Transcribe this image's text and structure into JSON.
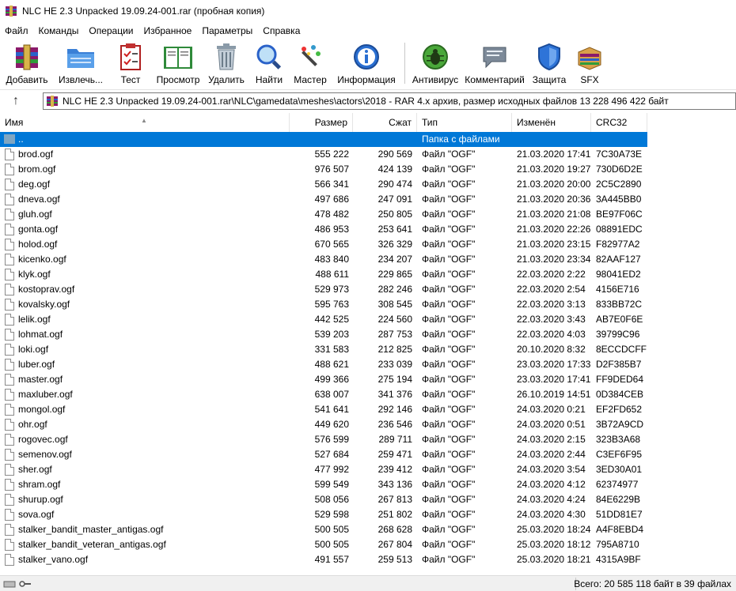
{
  "window": {
    "title": "NLC HE 2.3 Unpacked 19.09.24-001.rar (пробная копия)"
  },
  "menu": [
    "Файл",
    "Команды",
    "Операции",
    "Избранное",
    "Параметры",
    "Справка"
  ],
  "toolbar": [
    {
      "label": "Добавить",
      "icon": "archive-add-icon"
    },
    {
      "label": "Извлечь...",
      "icon": "folder-extract-icon"
    },
    {
      "label": "Тест",
      "icon": "test-checklist-icon"
    },
    {
      "label": "Просмотр",
      "icon": "book-view-icon"
    },
    {
      "label": "Удалить",
      "icon": "trash-icon"
    },
    {
      "label": "Найти",
      "icon": "magnifier-icon"
    },
    {
      "label": "Мастер",
      "icon": "wizard-wand-icon"
    },
    {
      "label": "Информация",
      "icon": "info-icon"
    },
    {
      "label": "Антивирус",
      "icon": "bug-antivirus-icon"
    },
    {
      "label": "Комментарий",
      "icon": "comment-icon"
    },
    {
      "label": "Защита",
      "icon": "shield-icon"
    },
    {
      "label": "SFX",
      "icon": "sfx-box-icon"
    }
  ],
  "address": {
    "path": "NLC HE 2.3 Unpacked 19.09.24-001.rar\\NLC\\gamedata\\meshes\\actors\\2018 - RAR 4.x архив, размер исходных файлов 13 228 496 422 байт"
  },
  "columns": {
    "name": "Имя",
    "size": "Размер",
    "packed": "Сжат",
    "type": "Тип",
    "modified": "Изменён",
    "crc": "CRC32"
  },
  "parent_row": {
    "name": "..",
    "type": "Папка с файлами"
  },
  "files": [
    {
      "name": "brod.ogf",
      "size": "555 222",
      "packed": "290 569",
      "type": "Файл \"OGF\"",
      "modified": "21.03.2020 17:41",
      "crc": "7C30A73E"
    },
    {
      "name": "brom.ogf",
      "size": "976 507",
      "packed": "424 139",
      "type": "Файл \"OGF\"",
      "modified": "21.03.2020 19:27",
      "crc": "730D6D2E"
    },
    {
      "name": "deg.ogf",
      "size": "566 341",
      "packed": "290 474",
      "type": "Файл \"OGF\"",
      "modified": "21.03.2020 20:00",
      "crc": "2C5C2890"
    },
    {
      "name": "dneva.ogf",
      "size": "497 686",
      "packed": "247 091",
      "type": "Файл \"OGF\"",
      "modified": "21.03.2020 20:36",
      "crc": "3A445BB0"
    },
    {
      "name": "gluh.ogf",
      "size": "478 482",
      "packed": "250 805",
      "type": "Файл \"OGF\"",
      "modified": "21.03.2020 21:08",
      "crc": "BE97F06C"
    },
    {
      "name": "gonta.ogf",
      "size": "486 953",
      "packed": "253 641",
      "type": "Файл \"OGF\"",
      "modified": "21.03.2020 22:26",
      "crc": "08891EDC"
    },
    {
      "name": "holod.ogf",
      "size": "670 565",
      "packed": "326 329",
      "type": "Файл \"OGF\"",
      "modified": "21.03.2020 23:15",
      "crc": "F82977A2"
    },
    {
      "name": "kicenko.ogf",
      "size": "483 840",
      "packed": "234 207",
      "type": "Файл \"OGF\"",
      "modified": "21.03.2020 23:34",
      "crc": "82AAF127"
    },
    {
      "name": "klyk.ogf",
      "size": "488 611",
      "packed": "229 865",
      "type": "Файл \"OGF\"",
      "modified": "22.03.2020 2:22",
      "crc": "98041ED2"
    },
    {
      "name": "kostoprav.ogf",
      "size": "529 973",
      "packed": "282 246",
      "type": "Файл \"OGF\"",
      "modified": "22.03.2020 2:54",
      "crc": "4156E716"
    },
    {
      "name": "kovalsky.ogf",
      "size": "595 763",
      "packed": "308 545",
      "type": "Файл \"OGF\"",
      "modified": "22.03.2020 3:13",
      "crc": "833BB72C"
    },
    {
      "name": "lelik.ogf",
      "size": "442 525",
      "packed": "224 560",
      "type": "Файл \"OGF\"",
      "modified": "22.03.2020 3:43",
      "crc": "AB7E0F6E"
    },
    {
      "name": "lohmat.ogf",
      "size": "539 203",
      "packed": "287 753",
      "type": "Файл \"OGF\"",
      "modified": "22.03.2020 4:03",
      "crc": "39799C96"
    },
    {
      "name": "loki.ogf",
      "size": "331 583",
      "packed": "212 825",
      "type": "Файл \"OGF\"",
      "modified": "20.10.2020 8:32",
      "crc": "8ECCDCFF"
    },
    {
      "name": "luber.ogf",
      "size": "488 621",
      "packed": "233 039",
      "type": "Файл \"OGF\"",
      "modified": "23.03.2020 17:33",
      "crc": "D2F385B7"
    },
    {
      "name": "master.ogf",
      "size": "499 366",
      "packed": "275 194",
      "type": "Файл \"OGF\"",
      "modified": "23.03.2020 17:41",
      "crc": "FF9DED64"
    },
    {
      "name": "maxluber.ogf",
      "size": "638 007",
      "packed": "341 376",
      "type": "Файл \"OGF\"",
      "modified": "26.10.2019 14:51",
      "crc": "0D384CEB"
    },
    {
      "name": "mongol.ogf",
      "size": "541 641",
      "packed": "292 146",
      "type": "Файл \"OGF\"",
      "modified": "24.03.2020 0:21",
      "crc": "EF2FD652"
    },
    {
      "name": "ohr.ogf",
      "size": "449 620",
      "packed": "236 546",
      "type": "Файл \"OGF\"",
      "modified": "24.03.2020 0:51",
      "crc": "3B72A9CD"
    },
    {
      "name": "rogovec.ogf",
      "size": "576 599",
      "packed": "289 711",
      "type": "Файл \"OGF\"",
      "modified": "24.03.2020 2:15",
      "crc": "323B3A68"
    },
    {
      "name": "semenov.ogf",
      "size": "527 684",
      "packed": "259 471",
      "type": "Файл \"OGF\"",
      "modified": "24.03.2020 2:44",
      "crc": "C3EF6F95"
    },
    {
      "name": "sher.ogf",
      "size": "477 992",
      "packed": "239 412",
      "type": "Файл \"OGF\"",
      "modified": "24.03.2020 3:54",
      "crc": "3ED30A01"
    },
    {
      "name": "shram.ogf",
      "size": "599 549",
      "packed": "343 136",
      "type": "Файл \"OGF\"",
      "modified": "24.03.2020 4:12",
      "crc": "62374977"
    },
    {
      "name": "shurup.ogf",
      "size": "508 056",
      "packed": "267 813",
      "type": "Файл \"OGF\"",
      "modified": "24.03.2020 4:24",
      "crc": "84E6229B"
    },
    {
      "name": "sova.ogf",
      "size": "529 598",
      "packed": "251 802",
      "type": "Файл \"OGF\"",
      "modified": "24.03.2020 4:30",
      "crc": "51DD81E7"
    },
    {
      "name": "stalker_bandit_master_antigas.ogf",
      "size": "500 505",
      "packed": "268 628",
      "type": "Файл \"OGF\"",
      "modified": "25.03.2020 18:24",
      "crc": "A4F8EBD4"
    },
    {
      "name": "stalker_bandit_veteran_antigas.ogf",
      "size": "500 505",
      "packed": "267 804",
      "type": "Файл \"OGF\"",
      "modified": "25.03.2020 18:12",
      "crc": "795A8710"
    },
    {
      "name": "stalker_vano.ogf",
      "size": "491 557",
      "packed": "259 513",
      "type": "Файл \"OGF\"",
      "modified": "25.03.2020 18:21",
      "crc": "4315A9BF"
    }
  ],
  "status": {
    "total": "Всего: 20 585 118 байт в 39 файлах"
  },
  "colors": {
    "selection": "#0078d7"
  }
}
